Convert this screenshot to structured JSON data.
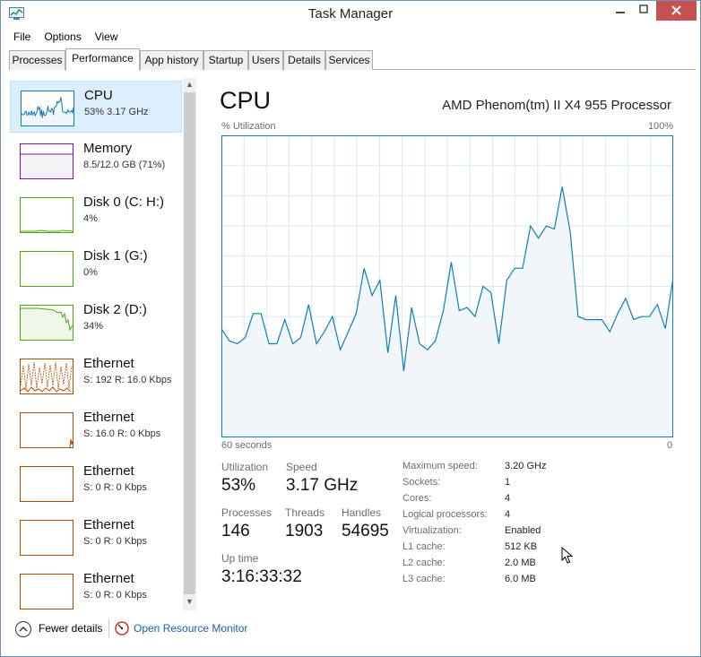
{
  "window": {
    "title": "Task Manager"
  },
  "menu": [
    "File",
    "Options",
    "View"
  ],
  "tabs": [
    "Processes",
    "Performance",
    "App history",
    "Startup",
    "Users",
    "Details",
    "Services"
  ],
  "active_tab": "Performance",
  "resources": [
    {
      "name": "CPU",
      "sub": "53%  3.17 GHz",
      "color": "#117dbb",
      "fill": "#f1f6fa"
    },
    {
      "name": "Memory",
      "sub": "8.5/12.0 GB (71%)",
      "color": "#8b12ae",
      "fill": "#f4f2f4"
    },
    {
      "name": "Disk 0 (C: H:)",
      "sub": "4%",
      "color": "#4da60c",
      "fill": "#ffffff"
    },
    {
      "name": "Disk 1 (G:)",
      "sub": "0%",
      "color": "#4da60c",
      "fill": "#ffffff"
    },
    {
      "name": "Disk 2 (D:)",
      "sub": "34%",
      "color": "#4da60c",
      "fill": "#eff7e9"
    },
    {
      "name": "Ethernet",
      "sub": "S: 192  R: 16.0 Kbps",
      "color": "#a74f01",
      "fill": "#ffffff"
    },
    {
      "name": "Ethernet",
      "sub": "S: 16.0  R: 0 Kbps",
      "color": "#a74f01",
      "fill": "#ffffff"
    },
    {
      "name": "Ethernet",
      "sub": "S: 0  R: 0 Kbps",
      "color": "#a74f01",
      "fill": "#ffffff"
    },
    {
      "name": "Ethernet",
      "sub": "S: 0  R: 0 Kbps",
      "color": "#a74f01",
      "fill": "#ffffff"
    },
    {
      "name": "Ethernet",
      "sub": "S: 0  R: 0 Kbps",
      "color": "#a74f01",
      "fill": "#ffffff"
    }
  ],
  "detail": {
    "title": "CPU",
    "model": "AMD Phenom(tm) II X4 955 Processor",
    "axis": {
      "top_left": "% Utilization",
      "top_right": "100%",
      "bottom_left": "60 seconds",
      "bottom_right": "0"
    },
    "stats": {
      "utilization_label": "Utilization",
      "utilization": "53%",
      "speed_label": "Speed",
      "speed": "3.17 GHz",
      "processes_label": "Processes",
      "processes": "146",
      "threads_label": "Threads",
      "threads": "1903",
      "handles_label": "Handles",
      "handles": "54695",
      "uptime_label": "Up time",
      "uptime": "3:16:33:32"
    },
    "specs": [
      {
        "label": "Maximum speed:",
        "value": "3.20 GHz"
      },
      {
        "label": "Sockets:",
        "value": "1"
      },
      {
        "label": "Cores:",
        "value": "4"
      },
      {
        "label": "Logical processors:",
        "value": "4"
      },
      {
        "label": "Virtualization:",
        "value": "Enabled"
      },
      {
        "label": "L1 cache:",
        "value": "512 KB"
      },
      {
        "label": "L2 cache:",
        "value": "2.0 MB"
      },
      {
        "label": "L3 cache:",
        "value": "6.0 MB"
      }
    ]
  },
  "cpu_history": [
    36,
    32,
    31,
    33,
    41,
    41,
    31,
    31,
    39,
    31,
    33,
    44,
    31,
    35,
    40,
    29,
    35,
    41,
    56,
    47,
    52,
    28,
    47,
    22,
    43,
    31,
    29,
    32,
    42,
    58,
    42,
    43,
    40,
    50,
    48,
    31,
    52,
    56,
    56,
    70,
    66,
    70,
    69,
    83,
    68,
    40,
    39,
    39,
    39,
    35,
    41,
    46,
    39,
    40,
    40,
    44,
    36,
    53
  ],
  "bottom": {
    "fewer_details": "Fewer details",
    "open_resource_monitor": "Open Resource Monitor"
  },
  "colors": {
    "cpu_line": "#117dbb",
    "cpu_fill": "#f1f6fa",
    "grid": "#d9eaf4",
    "link": "#1a5fb4"
  }
}
